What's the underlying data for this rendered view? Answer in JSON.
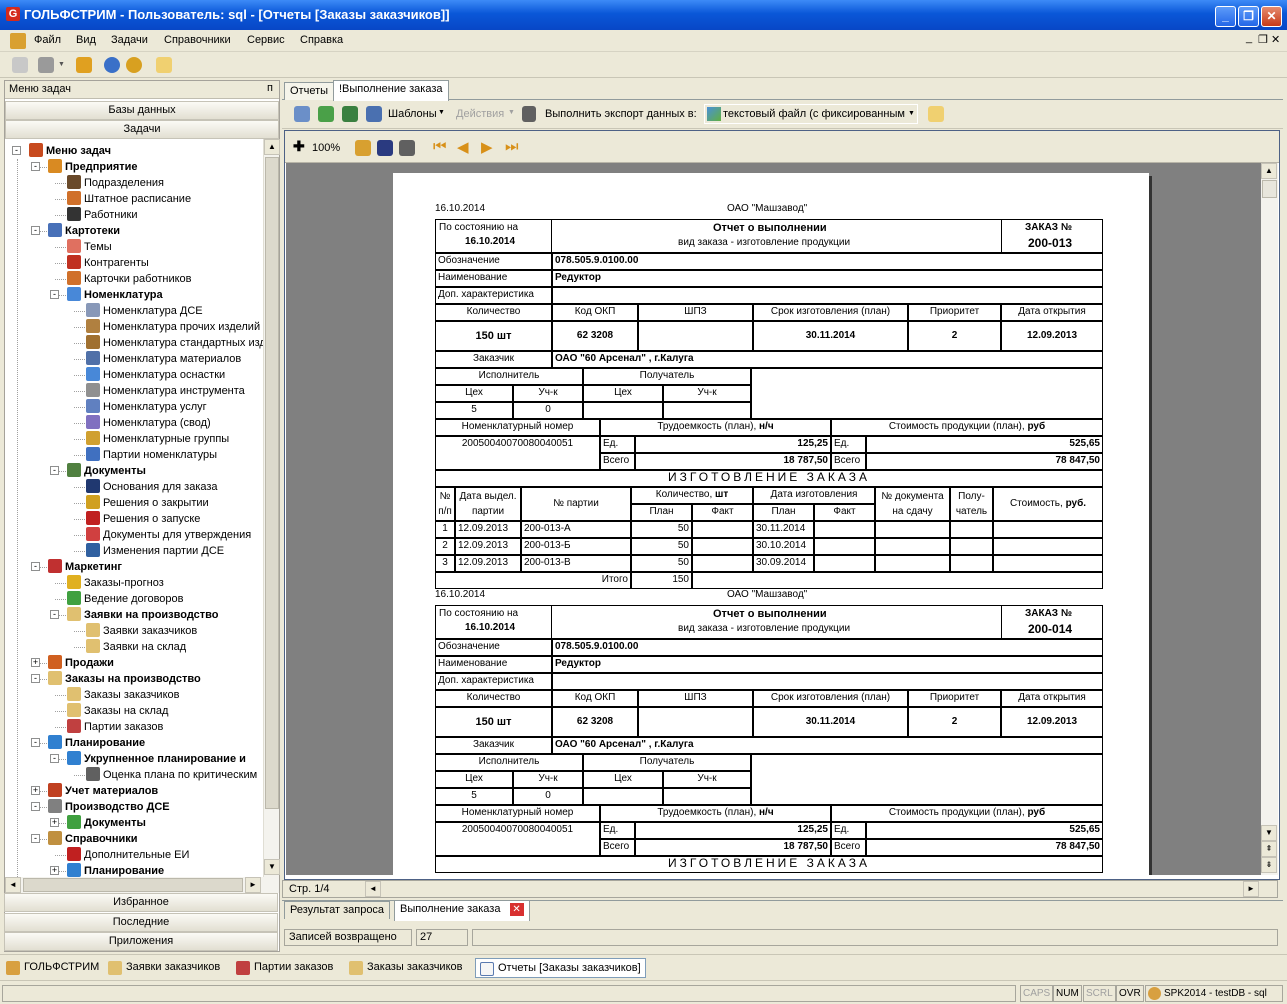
{
  "window": {
    "title": "ГОЛЬФСТРИМ - Пользователь: sql - [Отчеты  [Заказы заказчиков]]",
    "app_icon_letter": "G"
  },
  "menu": [
    "Файл",
    "Вид",
    "Задачи",
    "Справочники",
    "Сервис",
    "Справка"
  ],
  "left": {
    "header": "Меню задач",
    "pin": "ᴨ",
    "top_bars": [
      "Базы данных",
      "Задачи"
    ],
    "bottom_bars": [
      "Избранное",
      "Последние",
      "Приложения"
    ],
    "tree": [
      {
        "label": "Меню задач",
        "bold": true,
        "icon": "tree-root-icon",
        "color": "#c84a1e"
      },
      {
        "label": "Предприятие",
        "bold": true,
        "icon": "factory-icon",
        "color": "#d98a22"
      },
      {
        "label": "Подразделения",
        "icon": "buildings-icon",
        "color": "#6a4a2a"
      },
      {
        "label": "Штатное расписание",
        "icon": "people-icon",
        "color": "#d0702a"
      },
      {
        "label": "Работники",
        "icon": "worker-icon",
        "color": "#333"
      },
      {
        "label": "Картотеки",
        "bold": true,
        "icon": "cards-icon",
        "color": "#4870b8"
      },
      {
        "label": "Темы",
        "icon": "topic-icon",
        "color": "#e07060"
      },
      {
        "label": "Контрагенты",
        "icon": "contractor-icon",
        "color": "#c03020"
      },
      {
        "label": "Карточки работников",
        "icon": "worker-cards-icon",
        "color": "#d0702a"
      },
      {
        "label": "Номенклатура",
        "bold": true,
        "icon": "nomenclature-icon",
        "color": "#4888d8"
      },
      {
        "label": "Номенклатура ДСЕ",
        "icon": "gear-parts-icon",
        "color": "#8898b8"
      },
      {
        "label": "Номенклатура прочих изделий",
        "icon": "tools-icon",
        "color": "#b08040"
      },
      {
        "label": "Номенклатура стандартных изделий",
        "icon": "bolt-icon",
        "color": "#a07030"
      },
      {
        "label": "Номенклатура материалов",
        "icon": "materials-icon",
        "color": "#5070a8"
      },
      {
        "label": "Номенклатура оснастки",
        "icon": "tooling-icon",
        "color": "#4888d8"
      },
      {
        "label": "Номенклатура инструмента",
        "icon": "wrench-icon",
        "color": "#909090"
      },
      {
        "label": "Номенклатура услуг",
        "icon": "services-icon",
        "color": "#6080c0"
      },
      {
        "label": "Номенклатура (свод)",
        "icon": "summary-icon",
        "color": "#8070c0"
      },
      {
        "label": "Номенклатурные группы",
        "icon": "groups-icon",
        "color": "#d0a030"
      },
      {
        "label": "Партии номенклатуры",
        "icon": "batches-icon",
        "color": "#4070c0"
      },
      {
        "label": "Документы",
        "bold": true,
        "icon": "documents-icon",
        "color": "#508040"
      },
      {
        "label": "Основания для заказа",
        "icon": "order-basis-icon",
        "color": "#203870"
      },
      {
        "label": "Решения о закрытии",
        "icon": "close-decision-icon",
        "color": "#d0a020"
      },
      {
        "label": "Решения о запуске",
        "icon": "launch-decision-icon",
        "color": "#c02020"
      },
      {
        "label": "Документы для утверждения",
        "icon": "approve-docs-icon",
        "color": "#d04040"
      },
      {
        "label": "Изменения партии ДСЕ",
        "icon": "batch-change-icon",
        "color": "#3060a0"
      },
      {
        "label": "Маркетинг",
        "bold": true,
        "icon": "marketing-icon",
        "color": "#c03030"
      },
      {
        "label": "Заказы-прогноз",
        "icon": "forecast-icon",
        "color": "#e0b020"
      },
      {
        "label": "Ведение договоров",
        "icon": "contracts-icon",
        "color": "#40a040"
      },
      {
        "label": "Заявки на производство",
        "bold": true,
        "icon": "requests-icon",
        "color": "#e0c070"
      },
      {
        "label": "Заявки заказчиков",
        "icon": "customer-requests-icon",
        "color": "#e0c070"
      },
      {
        "label": "Заявки на склад",
        "icon": "warehouse-requests-icon",
        "color": "#e0c070"
      },
      {
        "label": "Продажи",
        "bold": true,
        "icon": "sales-icon",
        "color": "#d06020"
      },
      {
        "label": "Заказы на производство",
        "bold": true,
        "icon": "production-orders-icon",
        "color": "#e0c070"
      },
      {
        "label": "Заказы заказчиков",
        "icon": "customer-orders-icon",
        "color": "#e0c070"
      },
      {
        "label": "Заказы на склад",
        "icon": "warehouse-orders-icon",
        "color": "#e0c070"
      },
      {
        "label": "Партии заказов",
        "icon": "order-batches-icon",
        "color": "#c04040"
      },
      {
        "label": "Планирование",
        "bold": true,
        "icon": "planning-icon",
        "color": "#3080d0"
      },
      {
        "label": "Укрупненное планирование и",
        "bold": true,
        "icon": "aggregate-planning-icon",
        "color": "#3080d0"
      },
      {
        "label": "Оценка плана по критическим",
        "icon": "plan-assessment-icon",
        "color": "#606060"
      },
      {
        "label": "Учет материалов",
        "bold": true,
        "icon": "materials-accounting-icon",
        "color": "#c04020"
      },
      {
        "label": "Производство ДСЕ",
        "bold": true,
        "icon": "production-icon",
        "color": "#808080"
      },
      {
        "label": "Документы",
        "bold": true,
        "icon": "documents-green-icon",
        "color": "#40a040"
      },
      {
        "label": "Справочники",
        "bold": true,
        "icon": "directories-icon",
        "color": "#c09040"
      },
      {
        "label": "Дополнительные ЕИ",
        "icon": "units-icon",
        "color": "#c02020"
      },
      {
        "label": "Планирование",
        "bold": true,
        "icon": "planning2-icon",
        "color": "#3080d0"
      }
    ]
  },
  "tabs": [
    "Отчеты",
    "!Выполнение заказа"
  ],
  "reptools": {
    "templates": "Шаблоны",
    "actions": "Действия",
    "export_label": "Выполнить экспорт данных в:",
    "export_value": "текстовый файл (с фиксированным"
  },
  "viewer": {
    "zoom": "100%",
    "page_status": "Стр. 1/4"
  },
  "report": [
    {
      "date": "16.10.2014",
      "company": "ОАО \"Машзавод\"",
      "state_label": "По состоянию на",
      "state_date": "16.10.2014",
      "title": "Отчет о выполнении",
      "subtitle": "вид заказа - изготовление продукции",
      "order_label": "ЗАКАЗ №",
      "order_no": "200-013",
      "designation_label": "Обозначение",
      "designation": "078.505.9.0100.00",
      "name_label": "Наименование",
      "name": "Редуктор",
      "extra_label": "Доп. характеристика",
      "qty_h": "Количество",
      "okp_h": "Код ОКП",
      "shpz_h": "ШПЗ",
      "term_h": "Срок изготовления (план)",
      "prio_h": "Приоритет",
      "open_h": "Дата открытия",
      "qty": "150 шт",
      "okp": "62 3208",
      "term": "30.11.2014",
      "prio": "2",
      "open": "12.09.2013",
      "customer_label": "Заказчик",
      "customer": "ОАО \"60 Арсенал\" , г.Калуга",
      "executor": "Исполнитель",
      "receiver": "Получатель",
      "shop": "Цех",
      "section": "Уч-к",
      "exec_shop": "5",
      "exec_section": "0",
      "nomnum_label": "Номенклатурный номер",
      "labor_label": "Трудоемкость (план),",
      "labor_unit": "н/ч",
      "cost_label": "Стоимость продукции (план),",
      "cost_unit": "руб",
      "nomnum": "20050040070080040051",
      "unit_label": "Ед.",
      "total_label": "Всего",
      "labor_unit_val": "125,25",
      "labor_total": "18 787,50",
      "cost_unit_val": "525,65",
      "cost_total": "78 847,50",
      "section_title": "ИЗГОТОВЛЕНИЕ ЗАКАЗА",
      "grid_headers": {
        "no": "№ п/п",
        "date": "Дата выдел. партии",
        "batch": "№ партии",
        "qty": "Количество,",
        "qty_unit": "шт",
        "make_date": "Дата изготовления",
        "plan": "План",
        "fact": "Факт",
        "docno": "№ документа на сдачу",
        "recv": "Полу- чатель",
        "cost": "Стоимость,",
        "cost_unit": "руб."
      },
      "rows": [
        {
          "n": "1",
          "d": "12.09.2013",
          "b": "200-013-А",
          "p": "50",
          "pd": "30.11.2014"
        },
        {
          "n": "2",
          "d": "12.09.2013",
          "b": "200-013-Б",
          "p": "50",
          "pd": "30.10.2014"
        },
        {
          "n": "3",
          "d": "12.09.2013",
          "b": "200-013-В",
          "p": "50",
          "pd": "30.09.2014"
        }
      ],
      "itogo_label": "Итого",
      "itogo": "150"
    },
    {
      "date": "16.10.2014",
      "company": "ОАО \"Машзавод\"",
      "state_label": "По состоянию на",
      "state_date": "16.10.2014",
      "title": "Отчет о выполнении",
      "subtitle": "вид заказа - изготовление продукции",
      "order_label": "ЗАКАЗ №",
      "order_no": "200-014",
      "designation_label": "Обозначение",
      "designation": "078.505.9.0100.00",
      "name_label": "Наименование",
      "name": "Редуктор",
      "extra_label": "Доп. характеристика",
      "qty_h": "Количество",
      "okp_h": "Код ОКП",
      "shpz_h": "ШПЗ",
      "term_h": "Срок изготовления (план)",
      "prio_h": "Приоритет",
      "open_h": "Дата открытия",
      "qty": "150 шт",
      "okp": "62 3208",
      "term": "30.11.2014",
      "prio": "2",
      "open": "12.09.2013",
      "customer_label": "Заказчик",
      "customer": "ОАО \"60 Арсенал\" , г.Калуга",
      "executor": "Исполнитель",
      "receiver": "Получатель",
      "shop": "Цех",
      "section": "Уч-к",
      "exec_shop": "5",
      "exec_section": "0",
      "nomnum_label": "Номенклатурный номер",
      "labor_label": "Трудоемкость (план),",
      "labor_unit": "н/ч",
      "cost_label": "Стоимость продукции (план),",
      "cost_unit": "руб",
      "nomnum": "20050040070080040051",
      "unit_label": "Ед.",
      "total_label": "Всего",
      "labor_unit_val": "125,25",
      "labor_total": "18 787,50",
      "cost_unit_val": "525,65",
      "cost_total": "78 847,50",
      "section_title": "ИЗГОТОВЛЕНИЕ ЗАКАЗА"
    }
  ],
  "bottom_tabs": [
    "Результат запроса",
    "Выполнение заказа"
  ],
  "records": {
    "label": "Записей возвращено",
    "value": "27"
  },
  "taskbar": [
    "ГОЛЬФСТРИМ",
    "Заявки заказчиков",
    "Партии заказов",
    "Заказы заказчиков",
    "Отчеты  [Заказы заказчиков]"
  ],
  "status": {
    "caps": "CAPS",
    "num": "NUM",
    "scrl": "SCRL",
    "ovr": "OVR",
    "db": "SPK2014 - testDB - sql"
  }
}
